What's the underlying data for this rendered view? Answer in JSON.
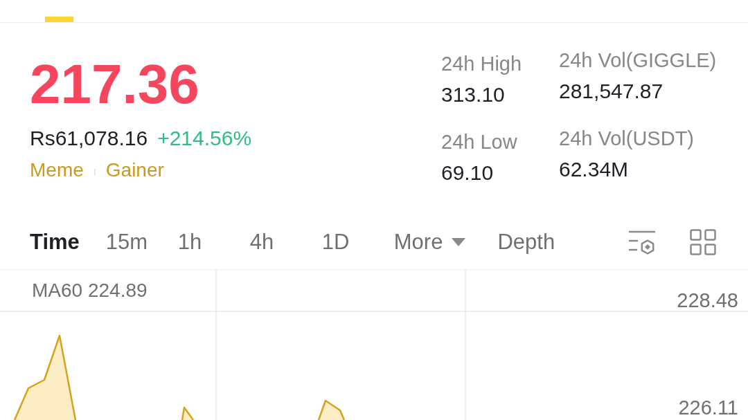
{
  "header_tabs": [
    {
      "selected": true
    }
  ],
  "ticker": {
    "last_price": {
      "text": "217.36",
      "falling": true
    },
    "fiat_price": "Rs61,078.16",
    "change": {
      "text": "+214.56%",
      "falling": false
    },
    "tags": [
      "Meme",
      "Gainer"
    ]
  },
  "stats": [
    {
      "label": "24h High",
      "value": "313.10"
    },
    {
      "label": "24h Vol(GIGGLE)",
      "value": "281,547.87"
    },
    {
      "label": "24h Low",
      "value": "69.10"
    },
    {
      "label": "24h Vol(USDT)",
      "value": "62.34M"
    }
  ],
  "intervals": [
    {
      "label": "Time",
      "selected": true,
      "kind": "tab"
    },
    {
      "label": "15m",
      "selected": false,
      "kind": "tab"
    },
    {
      "label": "1h",
      "selected": false,
      "kind": "tab"
    },
    {
      "label": "4h",
      "selected": false,
      "kind": "tab"
    },
    {
      "label": "1D",
      "selected": false,
      "kind": "tab"
    },
    {
      "label": "More",
      "selected": false,
      "kind": "dropdown"
    },
    {
      "label": "Depth",
      "selected": false,
      "kind": "tab"
    }
  ],
  "chart": {
    "indicator": "MA60 224.89",
    "price_labels": [
      "228.48",
      "226.11"
    ]
  }
}
